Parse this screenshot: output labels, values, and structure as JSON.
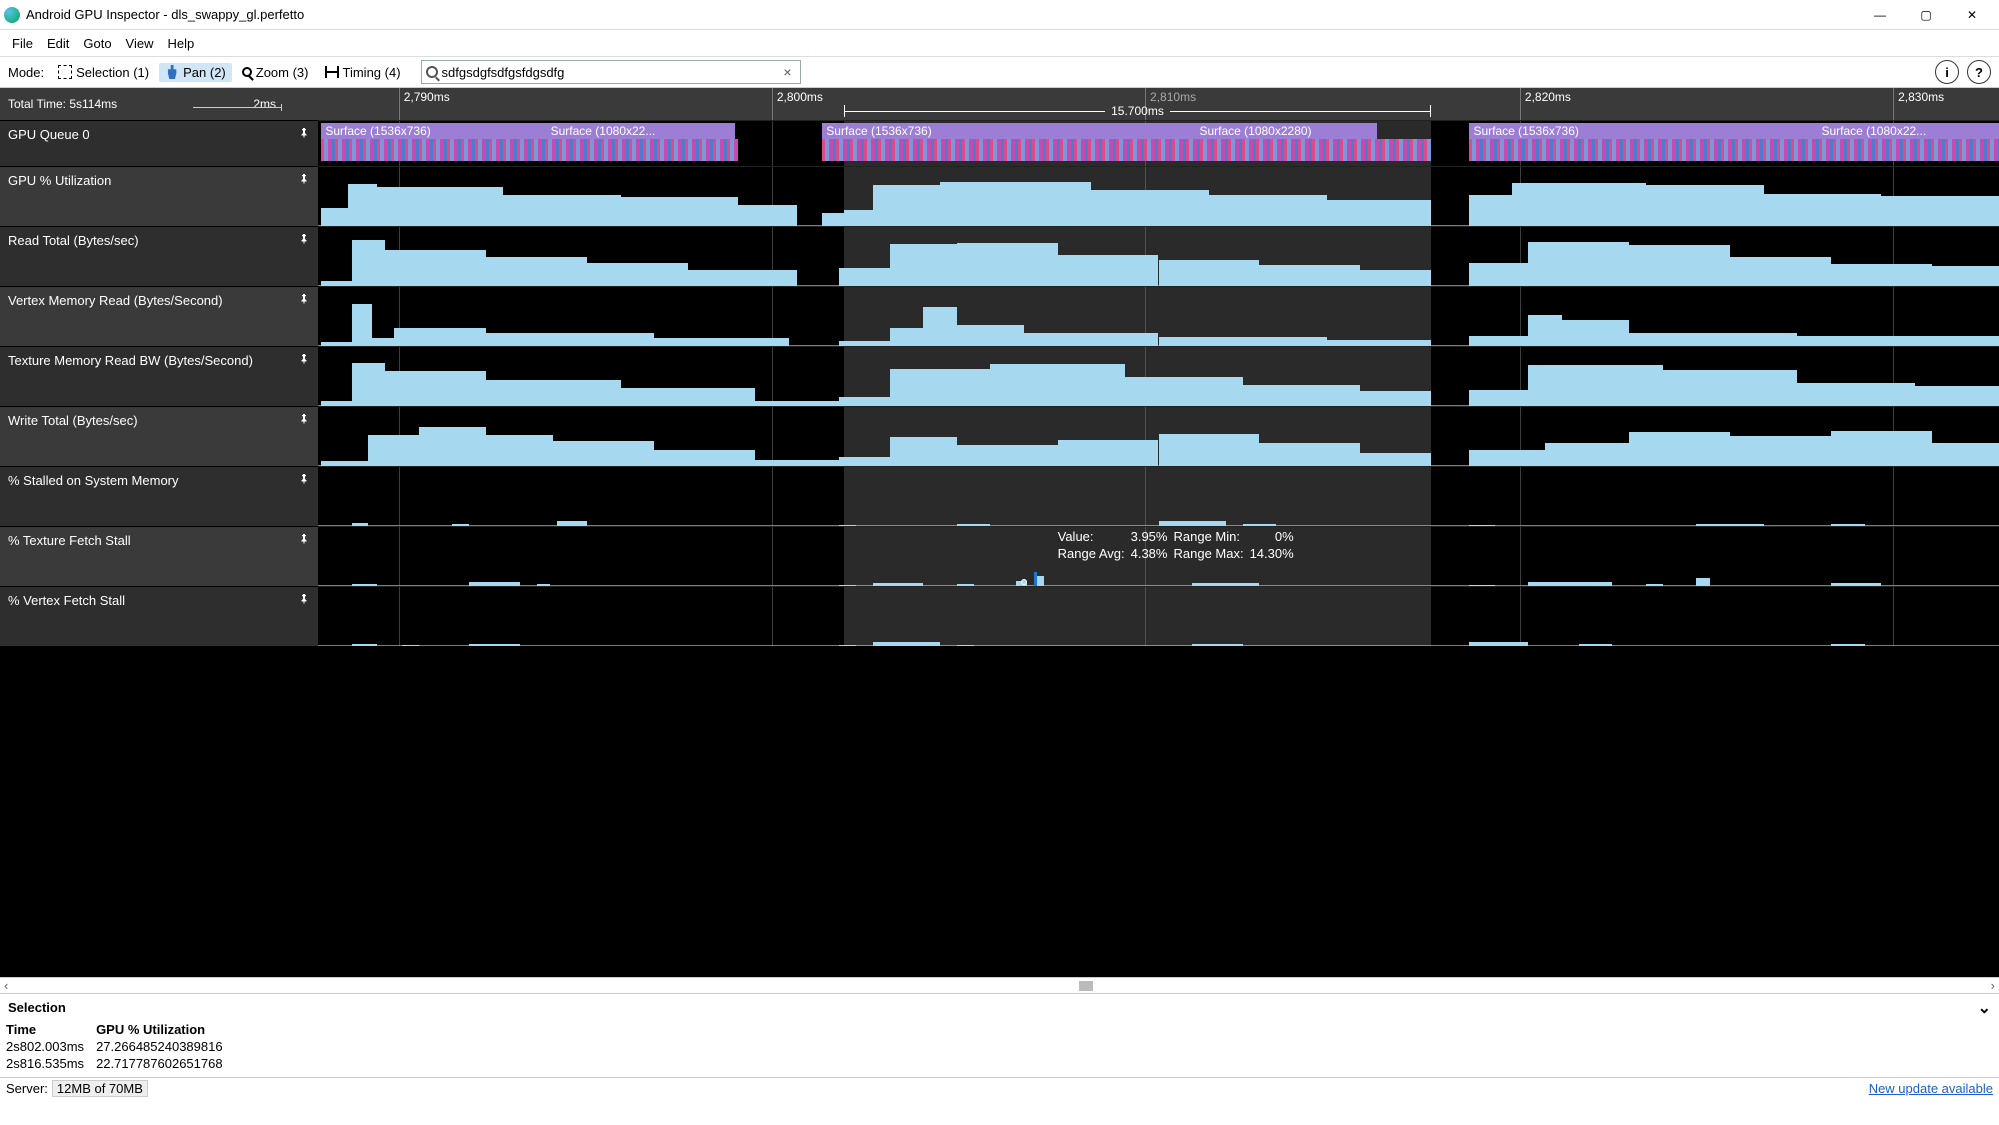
{
  "window": {
    "title": "Android GPU Inspector - dls_swappy_gl.perfetto"
  },
  "menu": [
    "File",
    "Edit",
    "Goto",
    "View",
    "Help"
  ],
  "toolbar": {
    "mode_label": "Mode:",
    "modes": [
      {
        "id": "selection",
        "label": "Selection (1)"
      },
      {
        "id": "pan",
        "label": "Pan (2)",
        "active": true
      },
      {
        "id": "zoom",
        "label": "Zoom (3)"
      },
      {
        "id": "timing",
        "label": "Timing (4)"
      }
    ],
    "search_value": "sdfgsdgfsdfgsfdgsdfg",
    "search_placeholder": ""
  },
  "ruler": {
    "total_time": "Total Time: 5s114ms",
    "scale_label": "2ms",
    "ticks": [
      {
        "label": "2,790ms",
        "pct": 4.8
      },
      {
        "label": "2,800ms",
        "pct": 27.0
      },
      {
        "label": "2,810ms",
        "pct": 49.2,
        "show_line_only": true
      },
      {
        "label": "2,820ms",
        "pct": 71.5
      },
      {
        "label": "2,830ms",
        "pct": 93.7
      }
    ],
    "measure": {
      "label": "15.700ms",
      "start_pct": 31.3,
      "end_pct": 66.2
    }
  },
  "selection_region": {
    "start_pct": 31.3,
    "end_pct": 66.2
  },
  "gridlines_pct": [
    4.8,
    27.0,
    49.2,
    71.5,
    93.7
  ],
  "tracks": [
    {
      "name": "GPU Queue 0",
      "type": "queue",
      "surfaces": [
        {
          "label": "Surface (1536x736)",
          "start": 0.2,
          "end": 13.6
        },
        {
          "label": "Surface (1080x22...",
          "start": 13.6,
          "end": 24.8
        },
        {
          "label": "Surface (1536x736)",
          "start": 30.0,
          "end": 52.2
        },
        {
          "label": "Surface (1080x2280)",
          "start": 52.2,
          "end": 63.0
        },
        {
          "label": "Surface (1536x736)",
          "start": 68.5,
          "end": 89.2
        },
        {
          "label": "Surface (1080x22...",
          "start": 89.2,
          "end": 100
        }
      ],
      "stripes": [
        [
          0.2,
          25.0
        ],
        [
          30.0,
          66.2
        ],
        [
          68.5,
          100
        ]
      ]
    },
    {
      "name": "GPU % Utilization",
      "type": "bars",
      "bars": [
        [
          0.2,
          1.8,
          35
        ],
        [
          1.8,
          3.5,
          80
        ],
        [
          3.5,
          11,
          75
        ],
        [
          11,
          18,
          60
        ],
        [
          18,
          25,
          55
        ],
        [
          25,
          28.5,
          40
        ],
        [
          28.5,
          30,
          0
        ],
        [
          30,
          31.3,
          25
        ],
        [
          31.3,
          33,
          30
        ],
        [
          33,
          37,
          78
        ],
        [
          37,
          46,
          85
        ],
        [
          46,
          53,
          70
        ],
        [
          53,
          60,
          60
        ],
        [
          60,
          66.2,
          50
        ],
        [
          66.2,
          68.5,
          0
        ],
        [
          68.5,
          71,
          60
        ],
        [
          71,
          79,
          82
        ],
        [
          79,
          86,
          78
        ],
        [
          86,
          93,
          62
        ],
        [
          93,
          100,
          58
        ]
      ]
    },
    {
      "name": "Read Total (Bytes/sec)",
      "type": "bars",
      "bars": [
        [
          0.2,
          2,
          10
        ],
        [
          2,
          4,
          88
        ],
        [
          4,
          10,
          70
        ],
        [
          10,
          16,
          55
        ],
        [
          16,
          22,
          45
        ],
        [
          22,
          28.5,
          30
        ],
        [
          28.5,
          31,
          0
        ],
        [
          31,
          34,
          35
        ],
        [
          34,
          38,
          80
        ],
        [
          38,
          44,
          82
        ],
        [
          44,
          50,
          60
        ],
        [
          50,
          56,
          50
        ],
        [
          56,
          62,
          40
        ],
        [
          62,
          66.2,
          30
        ],
        [
          66.2,
          68.5,
          0
        ],
        [
          68.5,
          72,
          45
        ],
        [
          72,
          78,
          85
        ],
        [
          78,
          84,
          78
        ],
        [
          84,
          90,
          56
        ],
        [
          90,
          96,
          42
        ],
        [
          96,
          100,
          38
        ]
      ]
    },
    {
      "name": "Vertex Memory Read (Bytes/Second)",
      "type": "bars",
      "bars": [
        [
          0.2,
          2,
          8
        ],
        [
          2,
          3.2,
          80
        ],
        [
          3.2,
          4.5,
          15
        ],
        [
          4.5,
          10,
          35
        ],
        [
          10,
          20,
          25
        ],
        [
          20,
          28,
          15
        ],
        [
          28,
          31,
          0
        ],
        [
          31,
          34,
          10
        ],
        [
          34,
          36,
          35
        ],
        [
          36,
          38,
          75
        ],
        [
          38,
          42,
          40
        ],
        [
          42,
          50,
          25
        ],
        [
          50,
          60,
          18
        ],
        [
          60,
          66.2,
          12
        ],
        [
          66.2,
          68.5,
          0
        ],
        [
          68.5,
          72,
          20
        ],
        [
          72,
          74,
          60
        ],
        [
          74,
          78,
          50
        ],
        [
          78,
          88,
          25
        ],
        [
          88,
          100,
          20
        ]
      ]
    },
    {
      "name": "Texture Memory Read BW (Bytes/Second)",
      "type": "bars",
      "bars": [
        [
          0.2,
          2,
          10
        ],
        [
          2,
          4,
          82
        ],
        [
          4,
          10,
          68
        ],
        [
          10,
          18,
          50
        ],
        [
          18,
          26,
          35
        ],
        [
          26,
          31,
          10
        ],
        [
          31,
          34,
          18
        ],
        [
          34,
          40,
          72
        ],
        [
          40,
          48,
          80
        ],
        [
          48,
          55,
          55
        ],
        [
          55,
          62,
          40
        ],
        [
          62,
          66.2,
          28
        ],
        [
          66.2,
          68.5,
          0
        ],
        [
          68.5,
          72,
          30
        ],
        [
          72,
          80,
          78
        ],
        [
          80,
          88,
          70
        ],
        [
          88,
          95,
          45
        ],
        [
          95,
          100,
          38
        ]
      ]
    },
    {
      "name": "Write Total (Bytes/sec)",
      "type": "bars",
      "bars": [
        [
          0.2,
          3,
          10
        ],
        [
          3,
          6,
          60
        ],
        [
          6,
          10,
          75
        ],
        [
          10,
          14,
          60
        ],
        [
          14,
          20,
          48
        ],
        [
          20,
          26,
          30
        ],
        [
          26,
          31,
          12
        ],
        [
          31,
          34,
          18
        ],
        [
          34,
          38,
          55
        ],
        [
          38,
          44,
          40
        ],
        [
          44,
          50,
          50
        ],
        [
          50,
          56,
          62
        ],
        [
          56,
          62,
          45
        ],
        [
          62,
          66.2,
          25
        ],
        [
          66.2,
          68.5,
          0
        ],
        [
          68.5,
          73,
          30
        ],
        [
          73,
          78,
          45
        ],
        [
          78,
          84,
          65
        ],
        [
          84,
          90,
          58
        ],
        [
          90,
          96,
          68
        ],
        [
          96,
          100,
          45
        ]
      ]
    },
    {
      "name": "% Stalled on System Memory",
      "type": "bars",
      "short": true,
      "bars": [
        [
          2,
          3,
          12
        ],
        [
          8,
          9,
          8
        ],
        [
          14.2,
          16,
          22
        ],
        [
          31,
          32,
          6
        ],
        [
          38,
          40,
          10
        ],
        [
          50,
          54,
          20
        ],
        [
          55,
          57,
          10
        ],
        [
          68.5,
          70,
          6
        ],
        [
          82,
          86,
          10
        ],
        [
          90,
          92,
          8
        ]
      ]
    },
    {
      "name": "% Texture Fetch Stall",
      "type": "bars",
      "short": true,
      "has_tooltip": true,
      "bars": [
        [
          2,
          3.5,
          10
        ],
        [
          9,
          12,
          18
        ],
        [
          13,
          13.8,
          8
        ],
        [
          31,
          32,
          6
        ],
        [
          33,
          36,
          12
        ],
        [
          38,
          39,
          8
        ],
        [
          41.5,
          42.2,
          20
        ],
        [
          42.6,
          43.2,
          40
        ],
        [
          52,
          56,
          12
        ],
        [
          68.5,
          70,
          6
        ],
        [
          72,
          77,
          16
        ],
        [
          79,
          80,
          8
        ],
        [
          82,
          82.8,
          35
        ],
        [
          90,
          93,
          12
        ]
      ]
    },
    {
      "name": "% Vertex Fetch Stall",
      "type": "bars",
      "short": true,
      "bars": [
        [
          2,
          3.5,
          10
        ],
        [
          5,
          6,
          6
        ],
        [
          9,
          12,
          10
        ],
        [
          31,
          32,
          6
        ],
        [
          33,
          37,
          16
        ],
        [
          38,
          39,
          6
        ],
        [
          52,
          55,
          8
        ],
        [
          68.5,
          72,
          18
        ],
        [
          75,
          77,
          10
        ],
        [
          90,
          92,
          8
        ]
      ]
    }
  ],
  "tooltip": {
    "track": "% Texture Fetch Stall",
    "labels": {
      "value": "Value:",
      "avg": "Range Avg:",
      "min": "Range Min:",
      "max": "Range Max:"
    },
    "value": "3.95%",
    "avg": "4.38%",
    "min": "0%",
    "max": "14.30%",
    "cursor_pct": 42.0
  },
  "selection_panel": {
    "title": "Selection",
    "columns": [
      "Time",
      "GPU % Utilization"
    ],
    "rows": [
      [
        "2s802.003ms",
        "27.266485240389816"
      ],
      [
        "2s816.535ms",
        "22.717787602651768"
      ]
    ]
  },
  "status": {
    "server_label": "Server:",
    "server_mem": "12MB of 70MB",
    "update_link": "New update available"
  }
}
